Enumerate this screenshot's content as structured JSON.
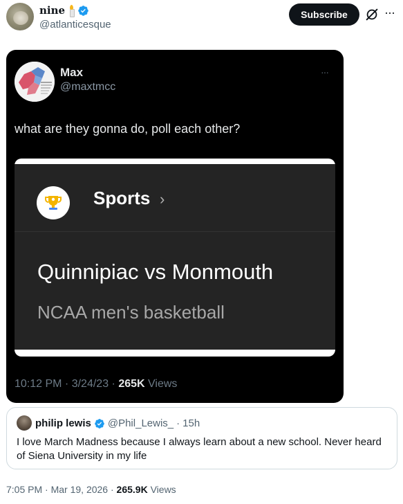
{
  "author": {
    "display_name": "nine",
    "handle": "@atlanticesque",
    "subscribe_label": "Subscribe"
  },
  "embedded_image": {
    "poster_name": "Max",
    "poster_handle": "@maxtmcc",
    "more_label": "···",
    "text": "what are they gonna do, poll each other?",
    "card": {
      "category": "Sports",
      "chevron": "›",
      "matchup": "Quinnipiac vs Monmouth",
      "league": "NCAA men's basketball"
    },
    "meta": {
      "time": "10:12 PM",
      "date": "3/24/23",
      "views_count": "265K",
      "views_label": "Views"
    }
  },
  "quoted_tweet": {
    "name": "philip lewis",
    "handle": "@Phil_Lewis_",
    "age": "15h",
    "text": "I love March Madness because I always learn about a new school. Never heard of Siena University in my life"
  },
  "footer": {
    "time": "7:05 PM",
    "date": "Mar 19, 2026",
    "views_count": "265.9K",
    "views_label": "Views"
  },
  "colors": {
    "verified": "#1d9bf0",
    "subscribe_bg": "#0f1419",
    "embed_bg": "#000000",
    "card_bg": "#242424"
  },
  "icons": [
    "candle-emoji",
    "verified-badge-icon",
    "grok-icon",
    "more-icon",
    "trophy-icon",
    "chevron-right-icon"
  ]
}
